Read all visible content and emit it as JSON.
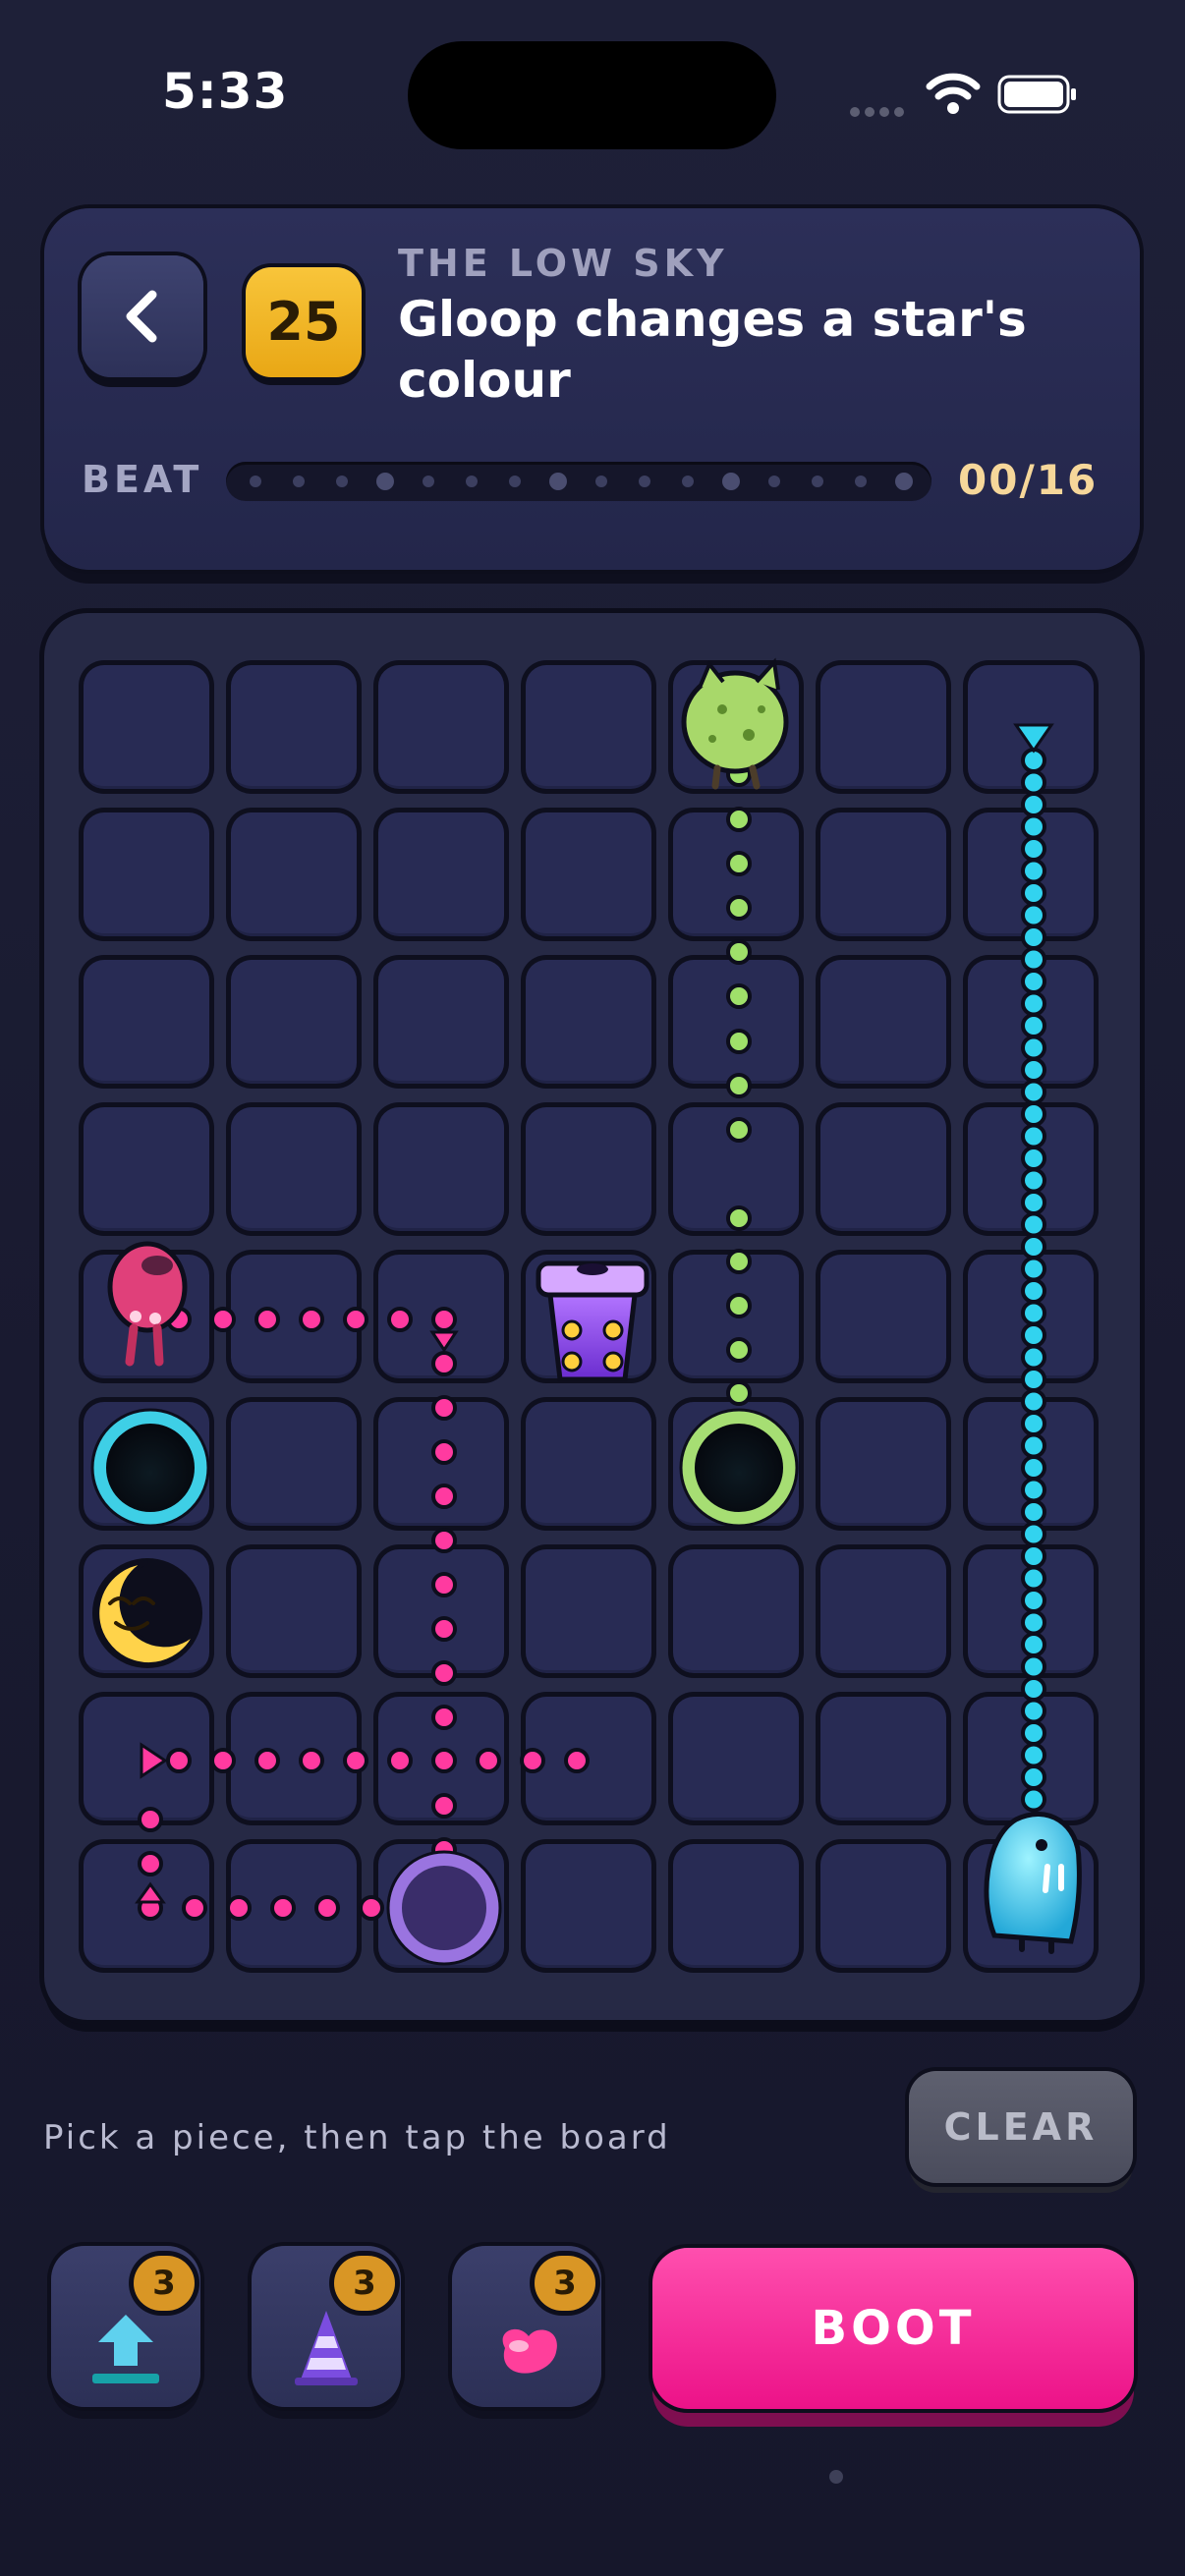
{
  "status_bar": {
    "time": "5:33"
  },
  "header": {
    "level_number": "25",
    "world_name": "THE LOW SKY",
    "level_title": "Gloop changes a star's colour",
    "beat_label": "BEAT",
    "beat_progress": "00/16"
  },
  "board": {
    "columns": 7,
    "rows": 9,
    "pieces": [
      {
        "name": "green-creature",
        "row": 1,
        "col": 5
      },
      {
        "name": "pink-creature",
        "row": 5,
        "col": 1
      },
      {
        "name": "purple-launcher",
        "row": 5,
        "col": 4
      },
      {
        "name": "cyan-ring-portal",
        "row": 6,
        "col": 1
      },
      {
        "name": "green-ring-portal",
        "row": 6,
        "col": 5
      },
      {
        "name": "crescent-moon",
        "row": 7,
        "col": 1
      },
      {
        "name": "purple-ring-portal",
        "row": 9,
        "col": 3
      },
      {
        "name": "blue-walrus-creature",
        "row": 9,
        "col": 7
      }
    ],
    "path_colors": {
      "green": "#9fe06a",
      "pink": "#ff3aa0",
      "cyan": "#32d3ef"
    }
  },
  "hint": "Pick a piece, then tap the board",
  "clear_label": "CLEAR",
  "tray": {
    "pieces": [
      {
        "icon": "up-arrow-icon",
        "count": "3"
      },
      {
        "icon": "cone-icon",
        "count": "3"
      },
      {
        "icon": "heart-blob-icon",
        "count": "3"
      }
    ]
  },
  "boot_label": "BOOT",
  "colors": {
    "accent_pink": "#ec1288",
    "badge_gold": "#f0b021",
    "panel": "#262945"
  }
}
